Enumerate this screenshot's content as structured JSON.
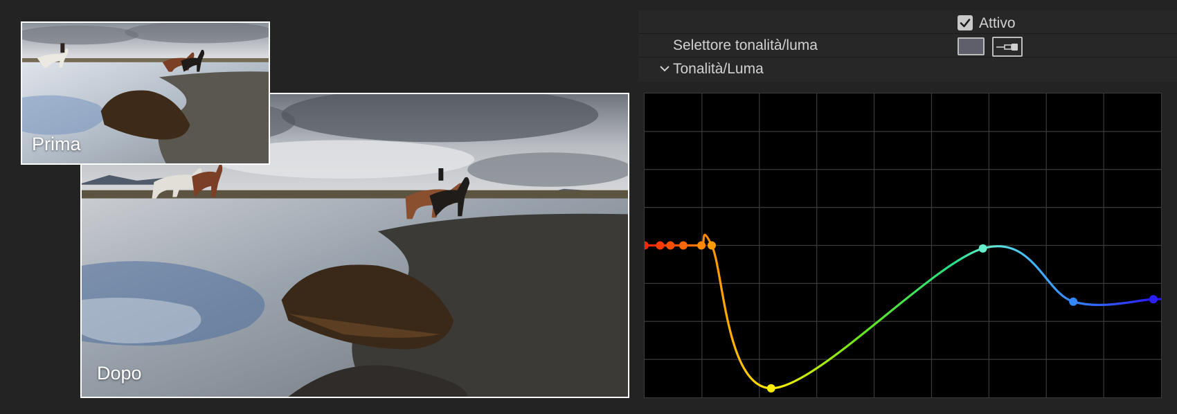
{
  "preview": {
    "before_label": "Prima",
    "after_label": "Dopo"
  },
  "controls": {
    "enabled_label": "Attivo",
    "enabled_checked": true,
    "selector_label": "Selettore tonalità/luma",
    "selector_swatch_color": "#5e5f6b",
    "section_label": "Tonalità/Luma"
  },
  "curve": {
    "points": [
      {
        "hue": 0.0,
        "value": 0.5,
        "color": "#ff2200"
      },
      {
        "hue": 0.03,
        "value": 0.5,
        "color": "#ff3a00"
      },
      {
        "hue": 0.05,
        "value": 0.5,
        "color": "#ff4f00"
      },
      {
        "hue": 0.075,
        "value": 0.5,
        "color": "#ff6800"
      },
      {
        "hue": 0.11,
        "value": 0.5,
        "color": "#ff8a00"
      },
      {
        "hue": 0.13,
        "value": 0.5,
        "color": "#ff9d00"
      },
      {
        "hue": 0.245,
        "value": 0.03,
        "color": "#ffee00"
      },
      {
        "hue": 0.655,
        "value": 0.49,
        "color": "#66eecc"
      },
      {
        "hue": 0.83,
        "value": 0.315,
        "color": "#3388ff"
      },
      {
        "hue": 0.985,
        "value": 0.323,
        "color": "#2a20ff"
      }
    ]
  }
}
